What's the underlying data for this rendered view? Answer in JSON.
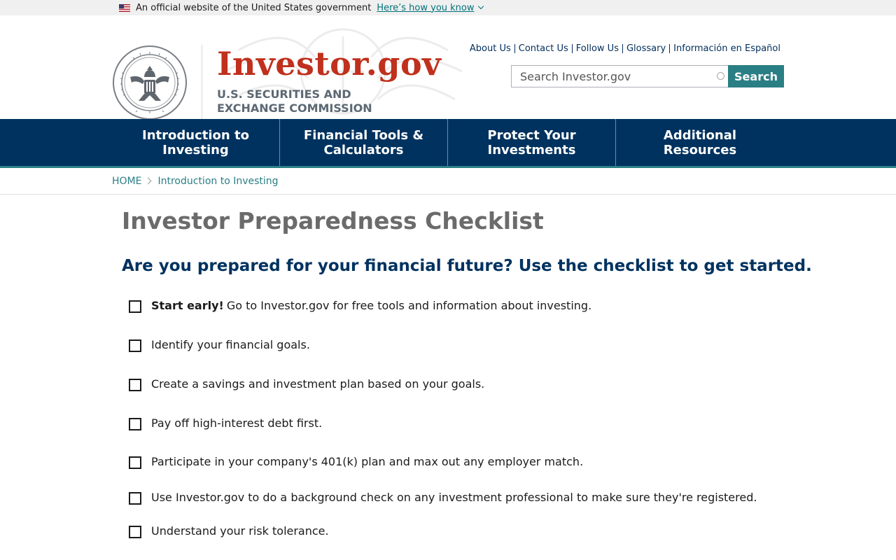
{
  "gov_banner": {
    "text": "An official website of the United States government",
    "link": "Here’s how you know"
  },
  "brand": {
    "name": "Investor.gov",
    "subtitle_line1": "U.S. SECURITIES AND",
    "subtitle_line2": "EXCHANGE COMMISSION"
  },
  "util_links": [
    "About Us",
    "Contact Us",
    "Follow Us",
    "Glossary",
    "Información en Español"
  ],
  "search": {
    "placeholder": "Search Investor.gov",
    "button": "Search"
  },
  "nav": {
    "items": [
      {
        "line1": "Introduction to",
        "line2": "Investing"
      },
      {
        "line1": "Financial Tools &",
        "line2": "Calculators"
      },
      {
        "line1": "Protect Your",
        "line2": "Investments"
      },
      {
        "line1": "Additional",
        "line2": "Resources"
      }
    ]
  },
  "breadcrumb": {
    "home": "HOME",
    "current": "Introduction to Investing"
  },
  "page": {
    "title": "Investor Preparedness Checklist",
    "subtitle": "Are you prepared for your financial future? Use the checklist to get started."
  },
  "checklist": [
    {
      "bold": "Start early!",
      "text": "Go to Investor.gov for free tools and information about investing."
    },
    {
      "bold": "",
      "text": "Identify your financial goals."
    },
    {
      "bold": "",
      "text": "Create a savings and investment plan based on your goals."
    },
    {
      "bold": "",
      "text": "Pay off high-interest debt first."
    },
    {
      "bold": "",
      "text": "Participate in your company's 401(k) plan and max out any employer match."
    },
    {
      "bold": "",
      "text": "Use Investor.gov to do a background check on any investment professional to make sure they're registered."
    },
    {
      "bold": "",
      "text": "Understand your risk tolerance."
    }
  ],
  "colors": {
    "brand_red": "#c0301d",
    "nav_navy": "#00325f",
    "teal": "#2a7f85"
  }
}
